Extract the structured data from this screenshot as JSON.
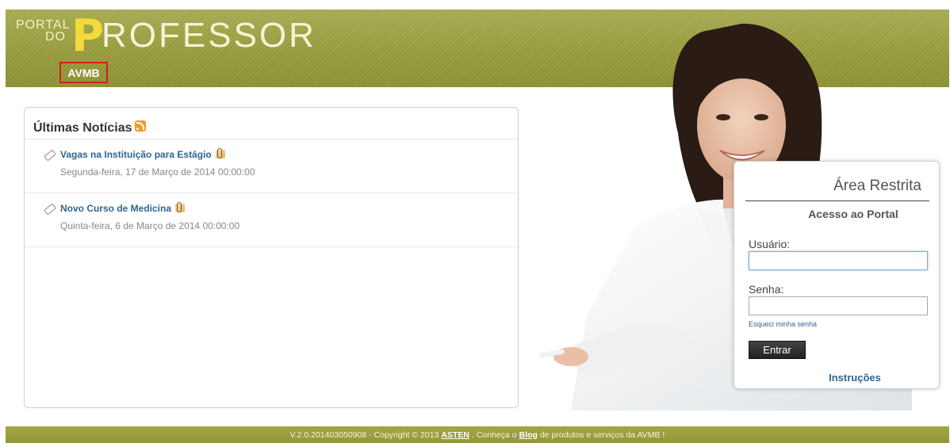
{
  "header": {
    "logo_word1": "PORTAL",
    "logo_word2": "DO",
    "logo_initial": "P",
    "logo_rest": "ROFESSOR",
    "org_badge": "AVMB"
  },
  "news": {
    "title": "Últimas Notícias",
    "items": [
      {
        "title": "Vagas na Instituição para Estágio",
        "date": "Segunda-feira, 17 de Março de 2014 00:00:00"
      },
      {
        "title": "Novo Curso de Medicina",
        "date": "Quinta-feira, 6 de Março de 2014 00:00:00"
      }
    ]
  },
  "login": {
    "title": "Área Restrita",
    "subtitle": "Acesso ao Portal",
    "user_label": "Usuário:",
    "user_value": "",
    "pass_label": "Senha:",
    "pass_value": "",
    "forgot_link": "Esqueci minha senha",
    "submit_label": "Entrar",
    "instructions_link": "Instruções"
  },
  "footer": {
    "prefix": "V.2.0.201403050908 - Copyright © 2013",
    "company_link": "ASTEN",
    "middle": ". Conheça o",
    "blog_link": "Blog",
    "suffix": "de produtos e serviços da AVMB !"
  },
  "colors": {
    "header_green": "#999d3e",
    "logo_yellow": "#f4da3a",
    "link_blue": "#2f6591",
    "badge_border": "#d41e1e"
  },
  "icons": {
    "rss": "rss-icon",
    "tag": "tag-icon",
    "attachment": "paperclip-icon"
  }
}
